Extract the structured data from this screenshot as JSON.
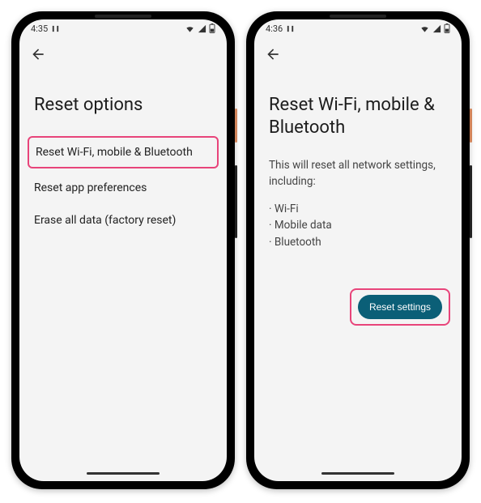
{
  "phones": [
    {
      "statusbar": {
        "time": "4:35"
      },
      "title": "Reset options",
      "options": [
        {
          "label": "Reset Wi-Fi, mobile & Bluetooth",
          "highlighted": true
        },
        {
          "label": "Reset app preferences",
          "highlighted": false
        },
        {
          "label": "Erase all data (factory reset)",
          "highlighted": false
        }
      ]
    },
    {
      "statusbar": {
        "time": "4:36"
      },
      "title": "Reset Wi-Fi, mobile & Bluetooth",
      "description": "This will reset all network settings, including:",
      "bullets": [
        "Wi-Fi",
        "Mobile data",
        "Bluetooth"
      ],
      "button": "Reset settings"
    }
  ]
}
